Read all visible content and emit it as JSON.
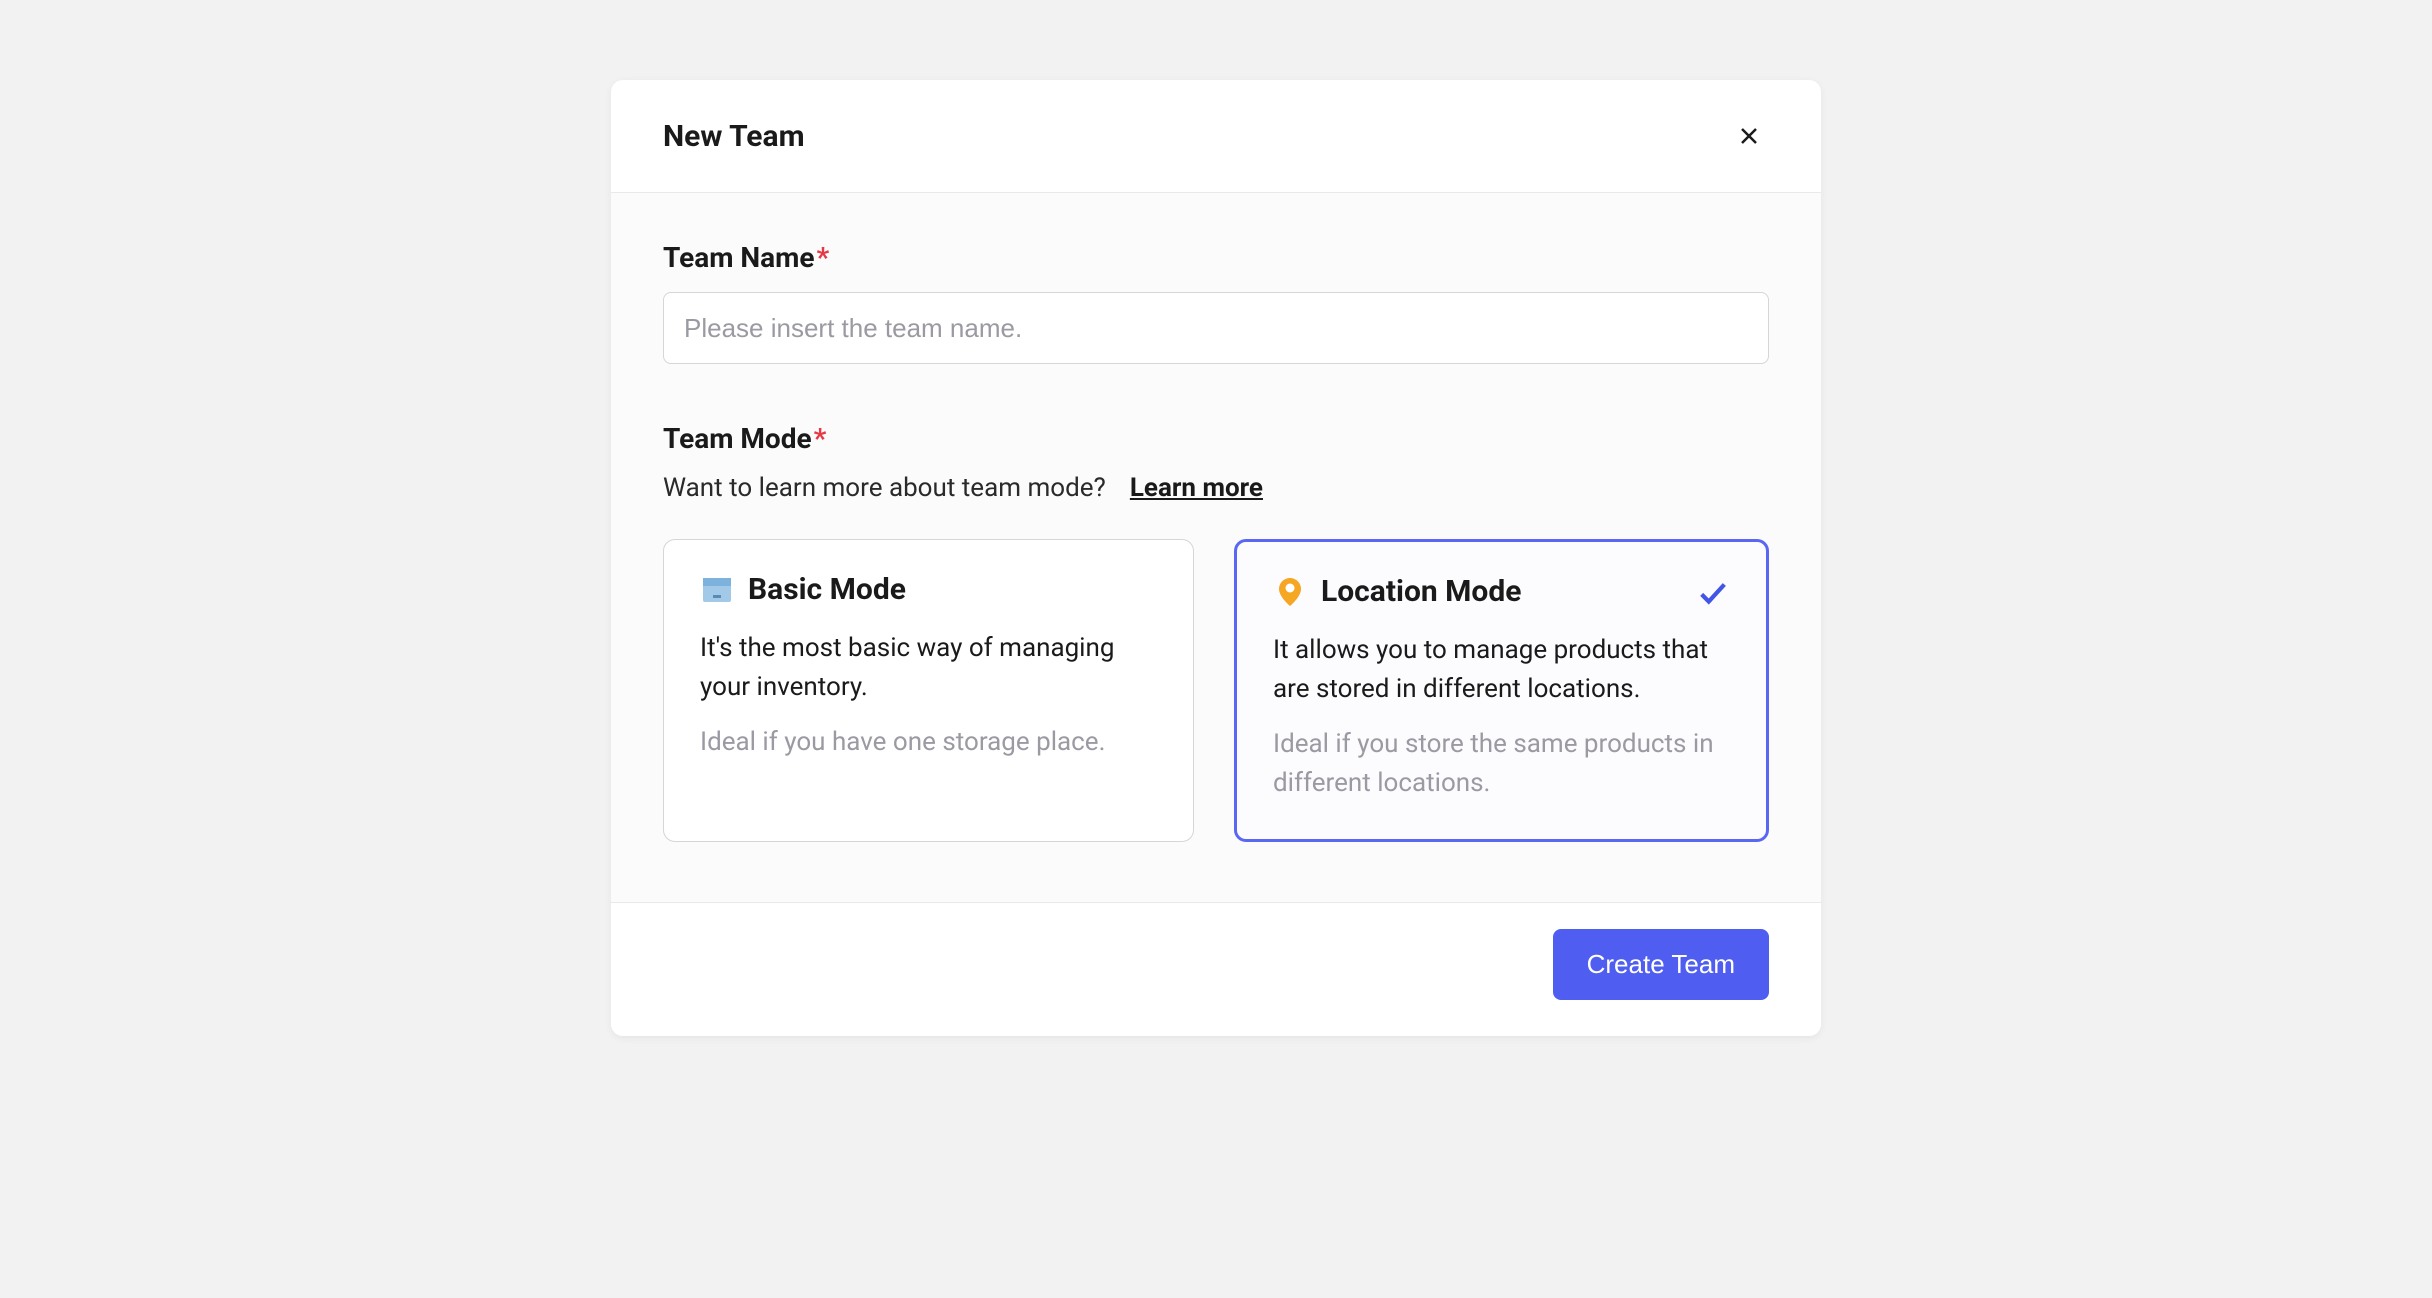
{
  "modal": {
    "title": "New Team",
    "teamName": {
      "label": "Team Name",
      "placeholder": "Please insert the team name.",
      "value": ""
    },
    "teamMode": {
      "label": "Team Mode",
      "helpText": "Want to learn more about team mode?",
      "learnMore": "Learn more",
      "options": [
        {
          "title": "Basic Mode",
          "description": "It's the most basic way of managing your inventory.",
          "subDescription": "Ideal if you have one storage place.",
          "selected": false
        },
        {
          "title": "Location Mode",
          "description": "It allows you to manage products that are stored in different locations.",
          "subDescription": "Ideal if you store the same products in different locations.",
          "selected": true
        }
      ]
    },
    "submitLabel": "Create Team"
  }
}
